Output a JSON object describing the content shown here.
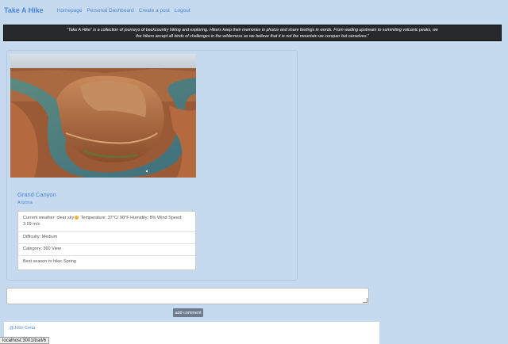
{
  "nav": {
    "brand": "Take A Hike",
    "links": [
      "Homepage",
      "Personal Dashboard",
      "Create a post",
      "Logout"
    ]
  },
  "tagline": {
    "line1": "\"Take A Hike\" is a collection of journeys of backcountry hiking and exploring. Hikers keep their memories in photos and share feelings in words. From wading upstream to summiting volcanic peaks, we",
    "line2": "the hikers accept all kinds of challenges in the wilderness as we believe that it is not the mountain we conquer but ourselves.\""
  },
  "trail": {
    "name": "Grand Canyon",
    "location": "Arizona",
    "weather_prefix": "Current weather: clear sky",
    "weather_suffix": " Temperature: 37°C/ 98°F Humidity: 8% Wind Speed: 3.09 m/s",
    "difficulty": "Difficulty: Medium",
    "category": "Category: 360 View",
    "season": "Best season to hike: Spring"
  },
  "comment": {
    "input_value": "",
    "add_label": "add comment",
    "first_user": "@John Cena"
  },
  "status_bar": {
    "url": "localhost:3001/trail/6"
  },
  "colors": {
    "background": "#c5d9ef",
    "link": "#4a86d4",
    "banner": "#27292c",
    "button": "#6c7c8e"
  }
}
